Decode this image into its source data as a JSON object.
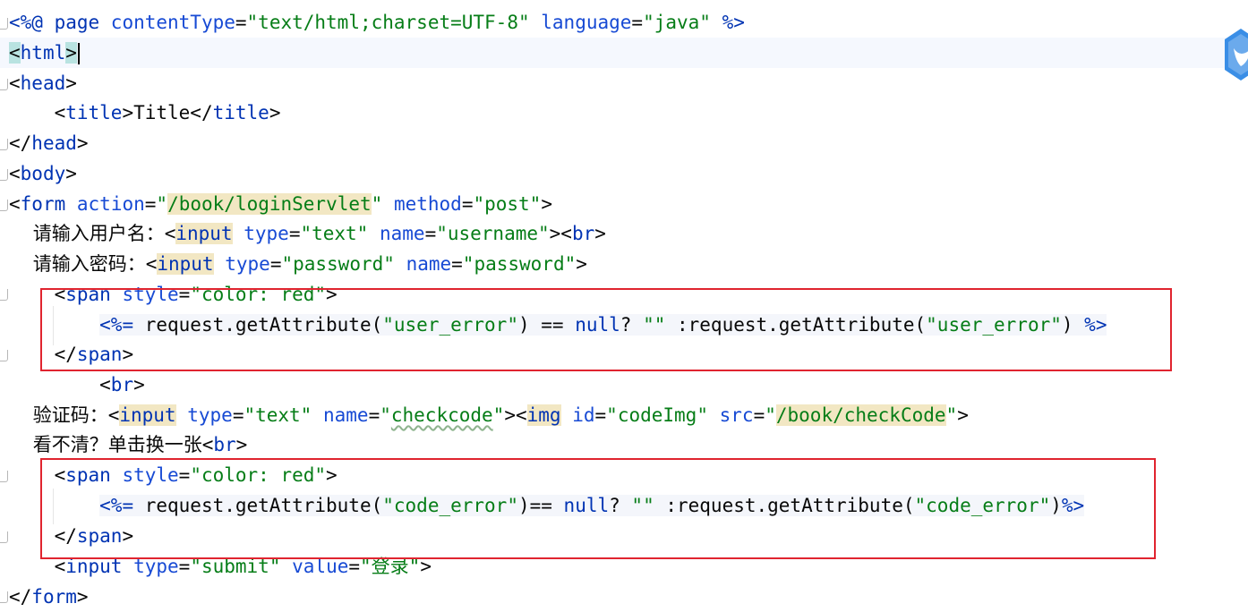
{
  "editor": {
    "lines": [
      {
        "tokens": [
          {
            "c": "tok-dir",
            "t": "<%@ page "
          },
          {
            "c": "tok-attr",
            "t": "contentType"
          },
          {
            "c": "tok-txt",
            "t": "="
          },
          {
            "c": "tok-str",
            "t": "\"text/html;charset=UTF-8\""
          },
          {
            "c": "tok-txt",
            "t": " "
          },
          {
            "c": "tok-attr",
            "t": "language"
          },
          {
            "c": "tok-txt",
            "t": "="
          },
          {
            "c": "tok-str",
            "t": "\"java\""
          },
          {
            "c": "tok-dir",
            "t": " %>"
          }
        ]
      },
      {
        "tokens": [
          {
            "c": "tok-txt hl-bracket",
            "t": "<"
          },
          {
            "c": "tok-tag",
            "t": "html"
          },
          {
            "c": "tok-txt hl-bracket",
            "t": ">"
          }
        ]
      },
      {
        "tokens": [
          {
            "c": "tok-txt",
            "t": "<"
          },
          {
            "c": "tok-tag",
            "t": "head"
          },
          {
            "c": "tok-txt",
            "t": ">"
          }
        ]
      },
      {
        "tokens": [
          {
            "c": "tok-txt",
            "t": "    <"
          },
          {
            "c": "tok-tag",
            "t": "title"
          },
          {
            "c": "tok-txt",
            "t": ">Title</"
          },
          {
            "c": "tok-tag",
            "t": "title"
          },
          {
            "c": "tok-txt",
            "t": ">"
          }
        ]
      },
      {
        "tokens": [
          {
            "c": "tok-txt",
            "t": "</"
          },
          {
            "c": "tok-tag",
            "t": "head"
          },
          {
            "c": "tok-txt",
            "t": ">"
          }
        ]
      },
      {
        "tokens": [
          {
            "c": "tok-txt",
            "t": "<"
          },
          {
            "c": "tok-tag",
            "t": "body"
          },
          {
            "c": "tok-txt",
            "t": ">"
          }
        ]
      },
      {
        "tokens": [
          {
            "c": "tok-txt",
            "t": "<"
          },
          {
            "c": "tok-tag",
            "t": "form"
          },
          {
            "c": "tok-txt",
            "t": " "
          },
          {
            "c": "tok-attr",
            "t": "action"
          },
          {
            "c": "tok-txt",
            "t": "="
          },
          {
            "c": "tok-str",
            "t": "\""
          },
          {
            "c": "tok-str hl-ref",
            "t": "/book/loginServlet"
          },
          {
            "c": "tok-str",
            "t": "\""
          },
          {
            "c": "tok-txt",
            "t": " "
          },
          {
            "c": "tok-attr",
            "t": "method"
          },
          {
            "c": "tok-txt",
            "t": "="
          },
          {
            "c": "tok-str",
            "t": "\"post\""
          },
          {
            "c": "tok-txt",
            "t": ">"
          }
        ]
      },
      {
        "tokens": [
          {
            "c": "tok-txt cjk",
            "t": "    请输入用户名："
          },
          {
            "c": "tok-txt",
            "t": "<"
          },
          {
            "c": "tok-tag hl-ref",
            "t": "input"
          },
          {
            "c": "tok-txt",
            "t": " "
          },
          {
            "c": "tok-attr",
            "t": "type"
          },
          {
            "c": "tok-txt",
            "t": "="
          },
          {
            "c": "tok-str",
            "t": "\"text\""
          },
          {
            "c": "tok-txt",
            "t": " "
          },
          {
            "c": "tok-attr",
            "t": "name"
          },
          {
            "c": "tok-txt",
            "t": "="
          },
          {
            "c": "tok-str",
            "t": "\"username\""
          },
          {
            "c": "tok-txt",
            "t": "><"
          },
          {
            "c": "tok-tag",
            "t": "br"
          },
          {
            "c": "tok-txt",
            "t": ">"
          }
        ]
      },
      {
        "tokens": [
          {
            "c": "tok-txt cjk",
            "t": "    请输入密码："
          },
          {
            "c": "tok-txt",
            "t": "<"
          },
          {
            "c": "tok-tag hl-ref",
            "t": "input"
          },
          {
            "c": "tok-txt",
            "t": " "
          },
          {
            "c": "tok-attr",
            "t": "type"
          },
          {
            "c": "tok-txt",
            "t": "="
          },
          {
            "c": "tok-str",
            "t": "\"password\""
          },
          {
            "c": "tok-txt",
            "t": " "
          },
          {
            "c": "tok-attr",
            "t": "name"
          },
          {
            "c": "tok-txt",
            "t": "="
          },
          {
            "c": "tok-str",
            "t": "\"password\""
          },
          {
            "c": "tok-txt",
            "t": ">"
          }
        ]
      },
      {
        "tokens": [
          {
            "c": "tok-txt",
            "t": "    <"
          },
          {
            "c": "tok-tag",
            "t": "span"
          },
          {
            "c": "tok-txt",
            "t": " "
          },
          {
            "c": "tok-attr",
            "t": "style"
          },
          {
            "c": "tok-txt",
            "t": "="
          },
          {
            "c": "tok-str",
            "t": "\"color: red\""
          },
          {
            "c": "tok-txt",
            "t": ">"
          }
        ]
      },
      {
        "tokens": [
          {
            "c": "tok-txt",
            "t": "        "
          },
          {
            "c": "tok-jsp jspbg",
            "t": "<%="
          },
          {
            "c": "tok-txt jspbg",
            "t": " request.getAttribute("
          },
          {
            "c": "tok-str jspbg",
            "t": "\"user_error\""
          },
          {
            "c": "tok-txt jspbg",
            "t": ") == "
          },
          {
            "c": "tok-kw jspbg",
            "t": "null"
          },
          {
            "c": "tok-txt jspbg",
            "t": "? "
          },
          {
            "c": "tok-str jspbg",
            "t": "\"\""
          },
          {
            "c": "tok-txt jspbg",
            "t": " :request.getAttribute("
          },
          {
            "c": "tok-str jspbg",
            "t": "\"user_error\""
          },
          {
            "c": "tok-txt jspbg",
            "t": ") "
          },
          {
            "c": "tok-jsp jspbg",
            "t": "%>"
          }
        ]
      },
      {
        "tokens": [
          {
            "c": "tok-txt",
            "t": "    </"
          },
          {
            "c": "tok-tag",
            "t": "span"
          },
          {
            "c": "tok-txt",
            "t": ">"
          }
        ]
      },
      {
        "tokens": [
          {
            "c": "tok-txt",
            "t": "        <"
          },
          {
            "c": "tok-tag",
            "t": "br"
          },
          {
            "c": "tok-txt",
            "t": ">"
          }
        ]
      },
      {
        "tokens": [
          {
            "c": "tok-txt cjk",
            "t": "    验证码："
          },
          {
            "c": "tok-txt",
            "t": "<"
          },
          {
            "c": "tok-tag hl-ref",
            "t": "input"
          },
          {
            "c": "tok-txt",
            "t": " "
          },
          {
            "c": "tok-attr",
            "t": "type"
          },
          {
            "c": "tok-txt",
            "t": "="
          },
          {
            "c": "tok-str",
            "t": "\"text\""
          },
          {
            "c": "tok-txt",
            "t": " "
          },
          {
            "c": "tok-attr",
            "t": "name"
          },
          {
            "c": "tok-txt",
            "t": "="
          },
          {
            "c": "tok-str",
            "t": "\""
          },
          {
            "c": "tok-str squiggle",
            "t": "checkcode"
          },
          {
            "c": "tok-str",
            "t": "\""
          },
          {
            "c": "tok-txt",
            "t": "><"
          },
          {
            "c": "tok-tag hl-ref",
            "t": "img"
          },
          {
            "c": "tok-txt",
            "t": " "
          },
          {
            "c": "tok-attr",
            "t": "id"
          },
          {
            "c": "tok-txt",
            "t": "="
          },
          {
            "c": "tok-str",
            "t": "\"codeImg\""
          },
          {
            "c": "tok-txt",
            "t": " "
          },
          {
            "c": "tok-attr",
            "t": "src"
          },
          {
            "c": "tok-txt",
            "t": "="
          },
          {
            "c": "tok-str",
            "t": "\""
          },
          {
            "c": "tok-str hl-ref",
            "t": "/book/checkCode"
          },
          {
            "c": "tok-str",
            "t": "\""
          },
          {
            "c": "tok-txt",
            "t": ">"
          }
        ]
      },
      {
        "tokens": [
          {
            "c": "tok-txt cjk",
            "t": "    看不清？单击换一张"
          },
          {
            "c": "tok-txt",
            "t": "<"
          },
          {
            "c": "tok-tag",
            "t": "br"
          },
          {
            "c": "tok-txt",
            "t": ">"
          }
        ]
      },
      {
        "tokens": [
          {
            "c": "tok-txt",
            "t": "    <"
          },
          {
            "c": "tok-tag",
            "t": "span"
          },
          {
            "c": "tok-txt",
            "t": " "
          },
          {
            "c": "tok-attr",
            "t": "style"
          },
          {
            "c": "tok-txt",
            "t": "="
          },
          {
            "c": "tok-str",
            "t": "\"color: red\""
          },
          {
            "c": "tok-txt",
            "t": ">"
          }
        ]
      },
      {
        "tokens": [
          {
            "c": "tok-txt",
            "t": "        "
          },
          {
            "c": "tok-jsp jspbg",
            "t": "<%="
          },
          {
            "c": "tok-txt jspbg",
            "t": " request.getAttribute("
          },
          {
            "c": "tok-str jspbg",
            "t": "\"code_error\""
          },
          {
            "c": "tok-txt jspbg",
            "t": ")== "
          },
          {
            "c": "tok-kw jspbg",
            "t": "null"
          },
          {
            "c": "tok-txt jspbg",
            "t": "? "
          },
          {
            "c": "tok-str jspbg",
            "t": "\"\""
          },
          {
            "c": "tok-txt jspbg",
            "t": " :request.getAttribute("
          },
          {
            "c": "tok-str jspbg",
            "t": "\"code_error\""
          },
          {
            "c": "tok-txt jspbg",
            "t": ")"
          },
          {
            "c": "tok-jsp jspbg",
            "t": "%>"
          }
        ]
      },
      {
        "tokens": [
          {
            "c": "tok-txt",
            "t": "    </"
          },
          {
            "c": "tok-tag",
            "t": "span"
          },
          {
            "c": "tok-txt",
            "t": ">"
          }
        ]
      },
      {
        "tokens": [
          {
            "c": "tok-txt",
            "t": "    <"
          },
          {
            "c": "tok-tag",
            "t": "input"
          },
          {
            "c": "tok-txt",
            "t": " "
          },
          {
            "c": "tok-attr",
            "t": "type"
          },
          {
            "c": "tok-txt",
            "t": "="
          },
          {
            "c": "tok-str",
            "t": "\"submit\""
          },
          {
            "c": "tok-txt",
            "t": " "
          },
          {
            "c": "tok-attr",
            "t": "value"
          },
          {
            "c": "tok-txt",
            "t": "="
          },
          {
            "c": "tok-str",
            "t": "\""
          },
          {
            "c": "tok-str cjk",
            "t": "登录"
          },
          {
            "c": "tok-str",
            "t": "\""
          },
          {
            "c": "tok-txt",
            "t": ">"
          }
        ]
      },
      {
        "tokens": [
          {
            "c": "tok-txt",
            "t": "</"
          },
          {
            "c": "tok-tag",
            "t": "form"
          },
          {
            "c": "tok-txt",
            "t": ">"
          }
        ]
      }
    ]
  },
  "colors": {
    "tag": "#0033b3",
    "attribute": "#174ad4",
    "string": "#067d17",
    "annotation_box": "#e0242f",
    "current_line": "#f5f8fe"
  },
  "icons": {
    "assistant": "assistant-badge-icon"
  }
}
